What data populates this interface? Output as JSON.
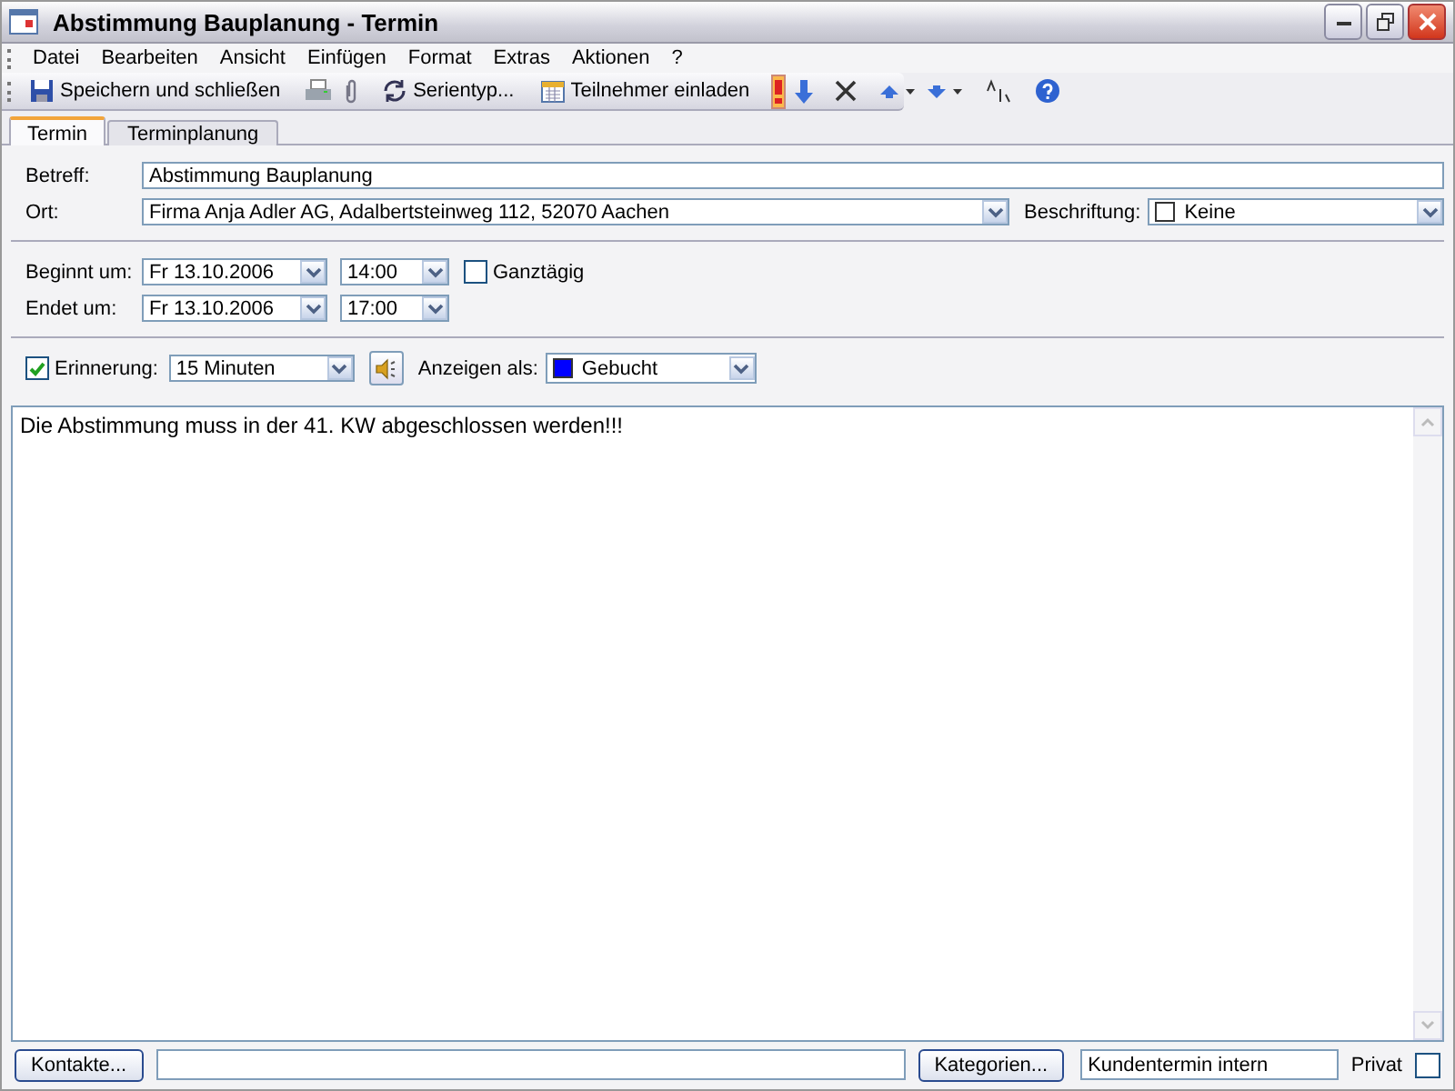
{
  "window": {
    "title": "Abstimmung Bauplanung - Termin"
  },
  "menu": [
    "Datei",
    "Bearbeiten",
    "Ansicht",
    "Einfügen",
    "Format",
    "Extras",
    "Aktionen",
    "?"
  ],
  "toolbar": {
    "save_label": "Speichern und schließen",
    "recurrence_label": "Serientyp...",
    "invite_label": "Teilnehmer einladen",
    "high_importance": true
  },
  "tabs": [
    {
      "label": "Termin",
      "selected": true
    },
    {
      "label": "Terminplanung",
      "selected": false
    }
  ],
  "subject": {
    "label": "Betreff:",
    "value": "Abstimmung Bauplanung"
  },
  "location": {
    "label": "Ort:",
    "value": "Firma Anja Adler AG, Adalbertsteinweg 112, 52070 Aachen"
  },
  "tag": {
    "label": "Beschriftung:",
    "value": "Keine"
  },
  "start": {
    "label": "Beginnt um:",
    "date": "Fr 13.10.2006",
    "time": "14:00"
  },
  "end": {
    "label": "Endet um:",
    "date": "Fr 13.10.2006",
    "time": "17:00"
  },
  "all_day": {
    "label": "Ganztägig",
    "checked": false
  },
  "reminder": {
    "label": "Erinnerung:",
    "checked": true,
    "value": "15 Minuten"
  },
  "show_as": {
    "label": "Anzeigen als:",
    "value": "Gebucht",
    "color": "#0000ff"
  },
  "body": "Die Abstimmung muss in der 41. KW abgeschlossen werden!!!",
  "contacts": {
    "button": "Kontakte..."
  },
  "categories": {
    "button": "Kategorien...",
    "value": "Kundentermin intern"
  },
  "private": {
    "label": "Privat",
    "checked": false
  }
}
